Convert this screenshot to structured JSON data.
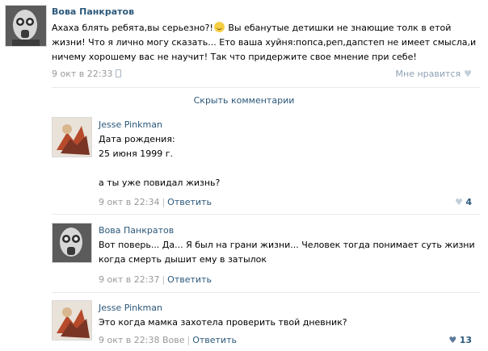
{
  "post": {
    "author": "Вова Панкратов",
    "text_1": "Ахаха блять ребята,вы серьезно?!",
    "text_2": " Вы ебанутые детишки не знающие толк в етой жизни! Что я лично могу сказать... Ето ваша хуйня:попса,реп,дапстеп не имеет смысла,и ничему хорошему вас не научит! Так что придержите свое мнение при себе!",
    "time": "9 окт в 22:33",
    "like_label": "Мне нравится",
    "emoji_icon": "laughing-emoji",
    "device_icon": "mobile-phone-icon"
  },
  "hide_comments_label": "Скрыть комментарии",
  "comments": [
    {
      "author": "Jesse Pinkman",
      "lines": [
        "Дата рождения:",
        "25 июня 1999 г.",
        "",
        "а ты уже повидал жизнь?"
      ],
      "time": "9 окт в 22:34",
      "reply_label": "Ответить",
      "likes": "4"
    },
    {
      "author": "Вова Панкратов",
      "text": "Вот поверь... Да... Я был на грани жизни... Человек тогда понимает суть жизни когда смерть дышит ему в затылок",
      "time": "9 окт в 22:37",
      "reply_label": "Ответить"
    },
    {
      "author": "Jesse Pinkman",
      "text": "Это когда мамка захотела проверить твой дневник?",
      "time": "9 окт в 22:38",
      "reply_to": "Вове",
      "reply_label": "Ответить",
      "likes": "13"
    }
  ],
  "colors": {
    "link": "#2b587a",
    "meta": "#999999",
    "divider": "#e7eaed",
    "like": "#8fa1b4"
  }
}
